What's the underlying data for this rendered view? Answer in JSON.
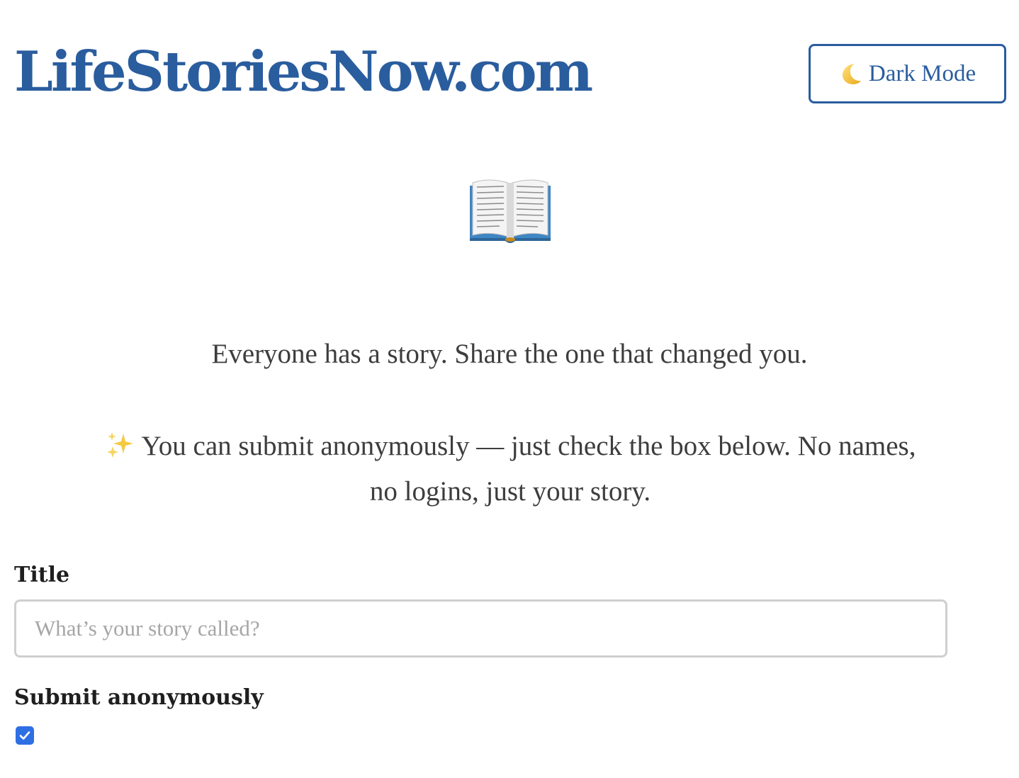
{
  "header": {
    "site_title": "LifeStoriesNow.com",
    "dark_mode_label": "Dark Mode",
    "dark_mode_icon": "crescent-moon-icon"
  },
  "hero": {
    "icon": "open-book-icon",
    "tagline": "Everyone has a story. Share the one that changed you.",
    "anon_icon": "sparkles-icon",
    "anon_note": "You can submit anonymously — just check the box below. No names, no logins, just your story."
  },
  "form": {
    "title_label": "Title",
    "title_value": "",
    "title_placeholder": "What’s your story called?",
    "anon_label": "Submit anonymously",
    "anon_checked": true
  },
  "colors": {
    "brand": "#2a5d9e",
    "text": "#3d3d3d",
    "checkbox": "#2f6fe4",
    "input_border": "#cfcfcf"
  }
}
